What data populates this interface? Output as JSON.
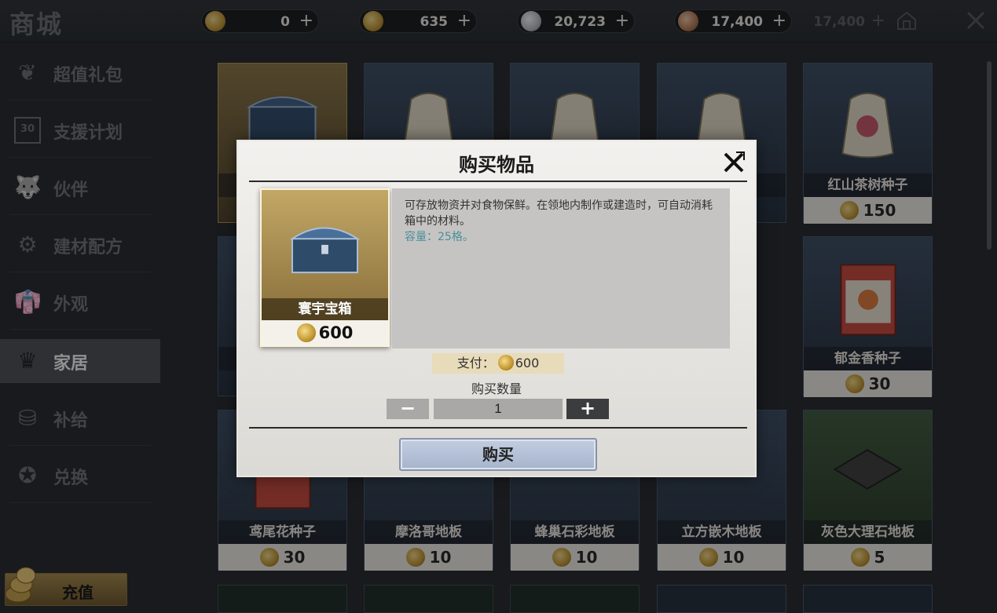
{
  "header": {
    "title": "商城",
    "currencies": [
      {
        "icon": "gold-coin-icon",
        "value": "0"
      },
      {
        "icon": "gold-coin-icon",
        "value": "635"
      },
      {
        "icon": "silver-coin-icon",
        "value": "20,723"
      },
      {
        "icon": "bronze-coin-icon",
        "value": "17,400"
      },
      {
        "icon": "coin-icon",
        "value": "17,400"
      }
    ],
    "plus_label": "+"
  },
  "sidebar": {
    "items": [
      {
        "label": "超值礼包",
        "icon": "gift-icon"
      },
      {
        "label": "支援计划",
        "icon": "calendar-icon"
      },
      {
        "label": "伙伴",
        "icon": "wolf-icon"
      },
      {
        "label": "建材配方",
        "icon": "blueprint-icon"
      },
      {
        "label": "外观",
        "icon": "outfit-icon"
      },
      {
        "label": "家居",
        "icon": "chair-icon"
      },
      {
        "label": "补给",
        "icon": "supply-icon"
      },
      {
        "label": "兑换",
        "icon": "exchange-icon"
      }
    ],
    "active_index": 5,
    "calendar_number": "30",
    "recharge_label": "充值"
  },
  "grid": {
    "cards": [
      {
        "name": "",
        "price": ""
      },
      {
        "name": "",
        "price": ""
      },
      {
        "name": "",
        "price": ""
      },
      {
        "name": "子",
        "price": ""
      },
      {
        "name": "红山茶树种子",
        "price": "150"
      },
      {
        "name": "",
        "price": ""
      },
      {
        "name": "郁金香种子",
        "price": "30"
      },
      {
        "name": "鸢尾花种子",
        "price": "30"
      },
      {
        "name": "摩洛哥地板",
        "price": "10"
      },
      {
        "name": "蜂巢石彩地板",
        "price": "10"
      },
      {
        "name": "立方嵌木地板",
        "price": "10"
      },
      {
        "name": "灰色大理石地板",
        "price": "5"
      }
    ]
  },
  "dialog": {
    "title": "购买物品",
    "item_name": "寰宇宝箱",
    "item_price": "600",
    "description": "可存放物资并对食物保鲜。在领地内制作或建造时，可自动消耗箱中的材料。",
    "capacity": "容量：25格。",
    "pay_label": "支付：",
    "pay_amount": "600",
    "quantity_label": "购买数量",
    "quantity": "1",
    "minus_label": "−",
    "plus_label": "+",
    "buy_label": "购买"
  },
  "colors": {
    "accent_gold": "#c2962f",
    "active_tab": "#4b4f54",
    "buy_button": "#a6b4cc",
    "capacity_text": "#4a8f9c"
  }
}
